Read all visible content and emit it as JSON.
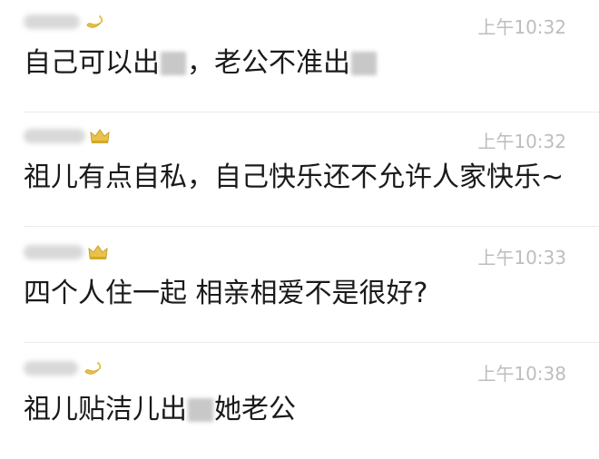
{
  "comments": [
    {
      "badge": "crescent-moon-icon",
      "time": "上午10:32",
      "text_parts": [
        "自己可以出",
        "，老公不准出"
      ]
    },
    {
      "badge": "crown-icon",
      "time": "上午10:32",
      "text": "祖儿有点自私，自己快乐还不允许人家快乐~"
    },
    {
      "badge": "crown-icon",
      "time": "上午10:33",
      "text": "四个人住一起 相亲相爱不是很好?"
    },
    {
      "badge": "crescent-moon-icon",
      "time": "上午10:38",
      "text_parts": [
        "祖儿贴洁儿出",
        "她老公"
      ]
    }
  ],
  "colors": {
    "text": "#1a1a1a",
    "time": "#bdbdbd",
    "badge_gold": "#e8c24a",
    "divider": "#ebebeb"
  }
}
